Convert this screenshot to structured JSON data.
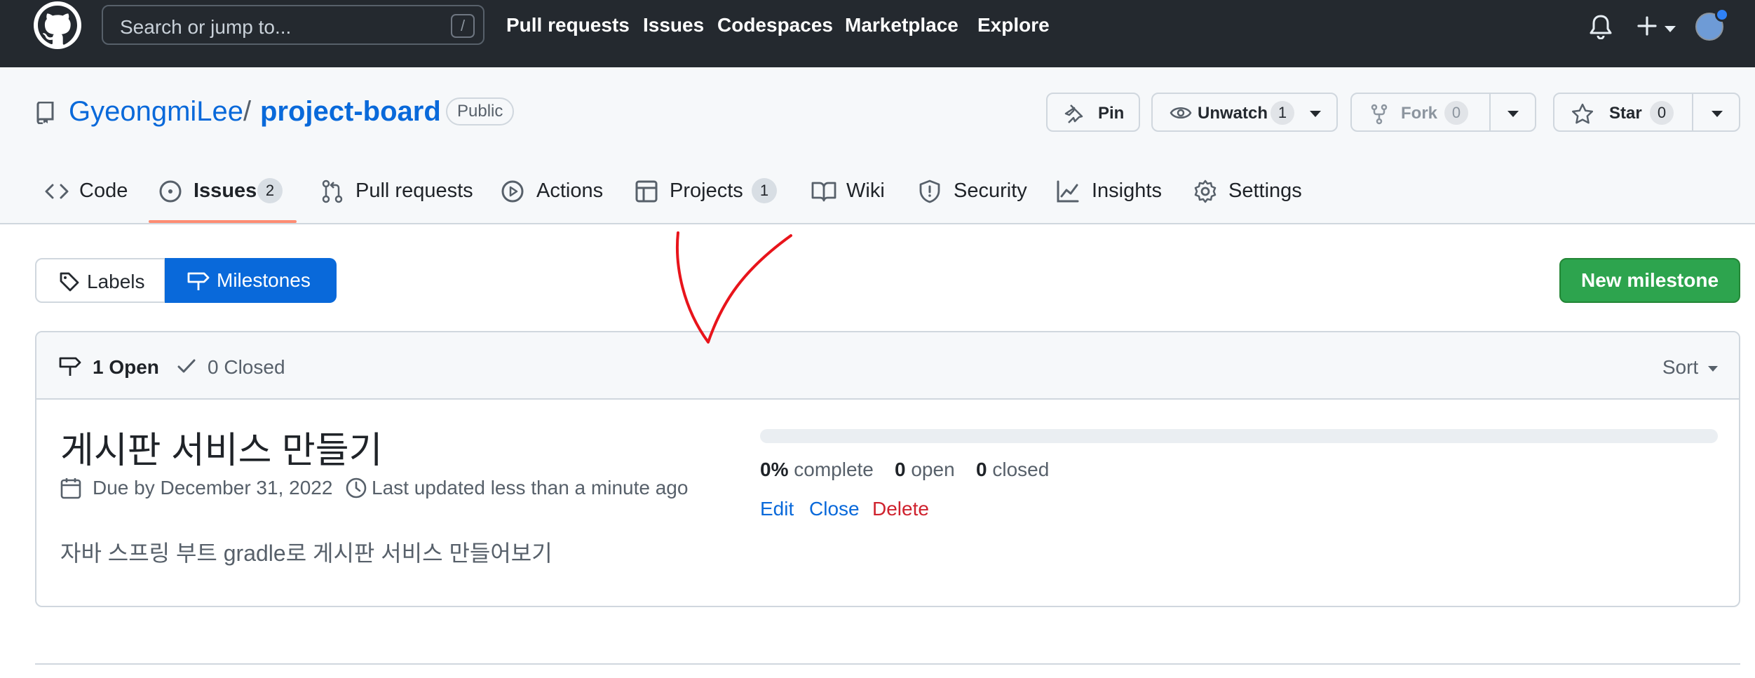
{
  "header": {
    "search_placeholder": "Search or jump to...",
    "search_shortcut": "/",
    "nav": [
      "Pull requests",
      "Issues",
      "Codespaces",
      "Marketplace",
      "Explore"
    ]
  },
  "repo": {
    "owner": "GyeongmiLee",
    "separator": "/",
    "name": "project-board",
    "visibility": "Public",
    "pin_label": "Pin",
    "unwatch_label": "Unwatch",
    "watch_count": "1",
    "fork_label": "Fork",
    "fork_count": "0",
    "star_label": "Star",
    "star_count": "0"
  },
  "tabs": [
    {
      "label": "Code"
    },
    {
      "label": "Issues",
      "count": "2"
    },
    {
      "label": "Pull requests"
    },
    {
      "label": "Actions"
    },
    {
      "label": "Projects",
      "count": "1"
    },
    {
      "label": "Wiki"
    },
    {
      "label": "Security"
    },
    {
      "label": "Insights"
    },
    {
      "label": "Settings"
    }
  ],
  "toolbar": {
    "labels": "Labels",
    "milestones": "Milestones",
    "new_milestone": "New milestone"
  },
  "milestones": {
    "open_label": "1 Open",
    "closed_label": "0 Closed",
    "sort": "Sort",
    "items": [
      {
        "title": "게시판 서비스 만들기",
        "due": "Due by December 31, 2022",
        "updated": "Last updated less than a minute ago",
        "description": "자바 스프링 부트 gradle로 게시판 서비스 만들어보기",
        "percent_complete": 0,
        "percent": "0%",
        "complete_word": "complete",
        "open_count": "0",
        "open_word": "open",
        "closed_count": "0",
        "closed_word": "closed",
        "edit": "Edit",
        "close": "Close",
        "delete": "Delete"
      }
    ]
  },
  "colors": {
    "header_bg": "#24292f",
    "accent_blue": "#0969da",
    "green": "#2da44e",
    "danger": "#cf222e",
    "tab_underline": "#fd8c73",
    "annotation_red": "#e8141b"
  }
}
